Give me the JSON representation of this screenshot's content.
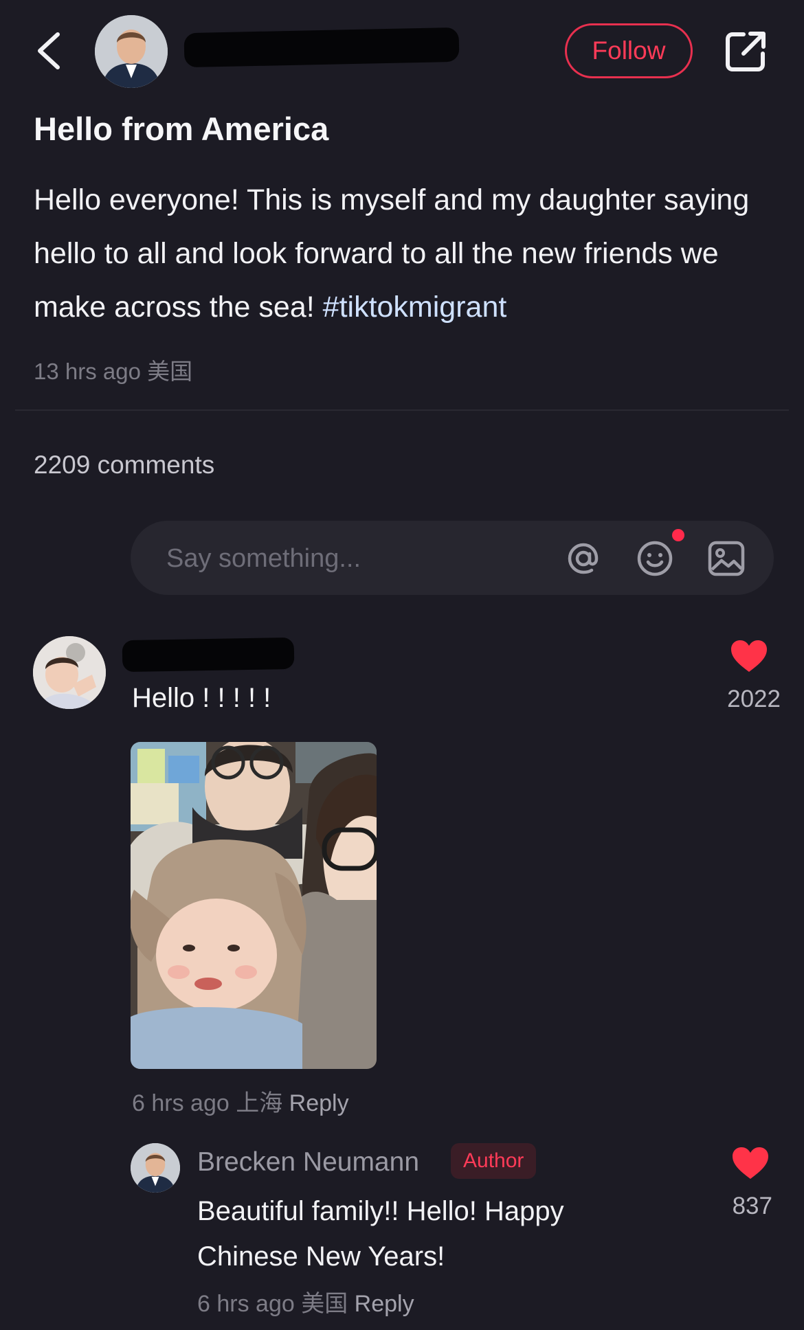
{
  "header": {
    "follow_label": "Follow"
  },
  "post": {
    "title": "Hello from America",
    "body": "Hello everyone! This is myself and my daughter saying hello to all and look forward to all the new friends we make across the sea!",
    "hashtag": "#tiktokmigrant",
    "time": "13 hrs ago",
    "location": "美国"
  },
  "comments_count": "2209 comments",
  "comment_input": {
    "placeholder": "Say something..."
  },
  "icons": {
    "back": "chevron-left-icon",
    "share": "external-share-icon",
    "mention": "at-icon",
    "emoji": "emoji-icon",
    "image": "image-icon",
    "like": "heart-icon"
  },
  "colors": {
    "background": "#1c1b24",
    "accent": "#ff3b58",
    "muted": "#7d7c86"
  },
  "comments": [
    {
      "text": "Hello ! ! ! ! !",
      "likes": "2022",
      "time": "6 hrs ago",
      "location": "上海",
      "reply_label": "Reply",
      "replies": [
        {
          "author": "Brecken Neumann",
          "badge": "Author",
          "text": "Beautiful family!! Hello! Happy Chinese New Years!",
          "likes": "837",
          "time": "6 hrs ago",
          "location": "美国",
          "reply_label": "Reply"
        }
      ]
    }
  ]
}
